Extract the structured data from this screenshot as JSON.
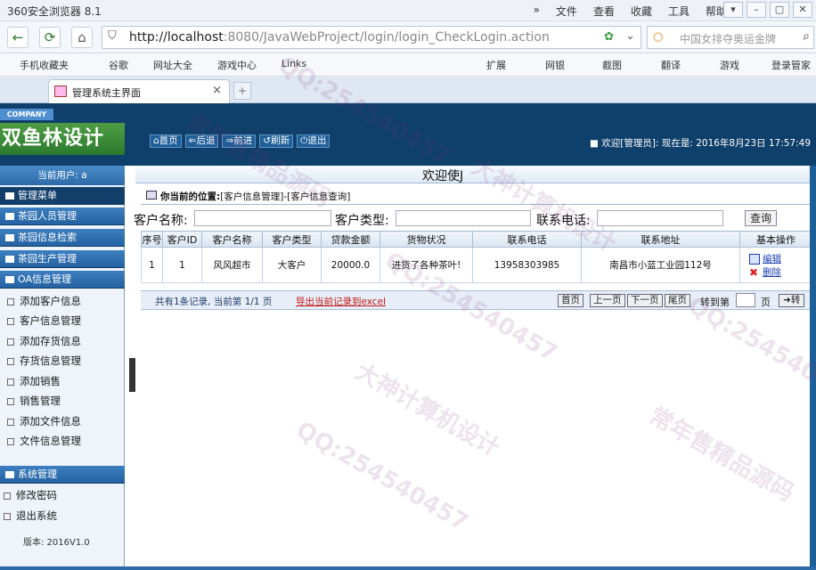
{
  "titlebar": {
    "app_name": "360安全浏览器 8.1",
    "menu": [
      "»",
      "文件",
      "查看",
      "收藏",
      "工具",
      "帮助"
    ],
    "controls": [
      "▾",
      "–",
      "▢",
      "✕"
    ]
  },
  "addressbar": {
    "url_host": "http://localhost",
    "url_rest": ":8080/JavaWebProject/login/login_CheckLogin.action",
    "search_placeholder": "中国女排夺奥运金牌"
  },
  "favorites": [
    "手机收藏夹",
    "谷歌",
    "网址大全",
    "游戏中心",
    "Links",
    "扩展",
    "网银",
    "截图",
    "翻译",
    "游戏",
    "登录管家"
  ],
  "tab": {
    "label": "管理系统主界面",
    "close": "×",
    "new": "+"
  },
  "app": {
    "company_tag": "COMPANY",
    "logo_text": "双鱼林设计",
    "toolbar": [
      "首页",
      "后退",
      "前进",
      "刷新",
      "退出"
    ],
    "welcome": "欢迎[管理员]: 现在是: 2016年8月23日 17:57:49"
  },
  "sidebar": {
    "current_user": "当前用户: a",
    "menu_title": "管理菜单",
    "sections": [
      "茶园人员管理",
      "茶园信息检索",
      "茶园生产管理"
    ],
    "oa": {
      "title": "OA信息管理",
      "items": [
        "添加客户信息",
        "客户信息管理",
        "添加存货信息",
        "存货信息管理",
        "添加销售",
        "销售管理",
        "添加文件信息",
        "文件信息管理"
      ]
    },
    "system": {
      "title": "系统管理",
      "items": [
        "修改密码",
        "退出系统"
      ]
    },
    "version": "版本: 2016V1.0"
  },
  "main": {
    "header": "欢迎使J",
    "location_label": "你当前的位置:",
    "location_path": "[客户信息管理]-[客户信息查询]",
    "search": {
      "name_label": "客户名称:",
      "type_label": "客户类型:",
      "phone_label": "联系电话:",
      "query_button": "查询"
    },
    "table": {
      "headers": [
        "序号",
        "客户ID",
        "客户名称",
        "客户类型",
        "贷款金额",
        "货物状况",
        "联系电话",
        "联系地址",
        "基本操作"
      ],
      "rows": [
        [
          "1",
          "1",
          "风风超市",
          "大客户",
          "20000.0",
          "进货了各种茶叶!",
          "13958303985",
          "南昌市小蓝工业园112号"
        ]
      ],
      "edit_label": "编辑",
      "delete_label": "删除"
    },
    "pager": {
      "info": "共有1条记录, 当前第 1/1 页",
      "export": "导出当前记录到excel",
      "first": "首页",
      "prev": "上一页",
      "next": "下一页",
      "last": "尾页",
      "goto_label": "转到第",
      "page_unit": "页",
      "go": "转"
    }
  },
  "watermarks": [
    "QQ:254540457",
    "大神计算机设计",
    "常年售精品源码"
  ]
}
